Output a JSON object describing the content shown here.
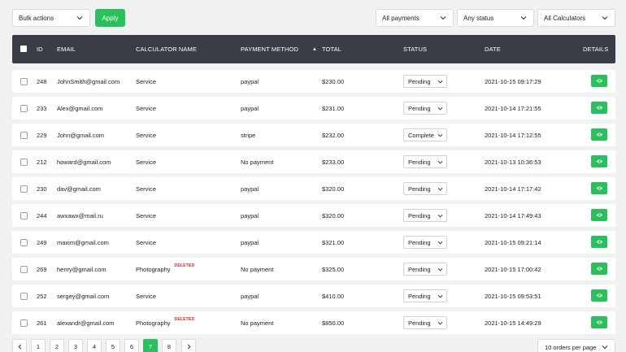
{
  "toolbar": {
    "bulk_actions": "Bulk actions",
    "apply_label": "Apply",
    "payments_filter": "All payments",
    "status_filter": "Any status",
    "calculators_filter": "All Calculators"
  },
  "table": {
    "headers": {
      "id": "ID",
      "email": "EMAIL",
      "calculator": "CALCULATOR NAME",
      "payment": "PAYMENT METHOD",
      "total": "TOTAL",
      "status": "STATUS",
      "date": "DATE",
      "details": "DETAILS"
    },
    "sort_indicator": "▲",
    "deleted_label": "DELETED",
    "rows": [
      {
        "id": "248",
        "email": "JohnSmith@gmail.com",
        "calculator": "Service",
        "deleted": false,
        "payment": "paypal",
        "total": "$230.00",
        "status": "Pending",
        "date": "2021-10-15 09:17:29"
      },
      {
        "id": "233",
        "email": "Alex@gmail.com",
        "calculator": "Service",
        "deleted": false,
        "payment": "paypal",
        "total": "$231.00",
        "status": "Pending",
        "date": "2021-10-14 17:21:55"
      },
      {
        "id": "229",
        "email": "John@gmail.com",
        "calculator": "Service",
        "deleted": false,
        "payment": "stripe",
        "total": "$232.00",
        "status": "Complete",
        "date": "2021-10-14 17:12:55"
      },
      {
        "id": "212",
        "email": "howard@gmail.com",
        "calculator": "Service",
        "deleted": false,
        "payment": "No payment",
        "total": "$233.00",
        "status": "Pending",
        "date": "2021-10-13 10:36:53"
      },
      {
        "id": "230",
        "email": "dav@gmail.com",
        "calculator": "Service",
        "deleted": false,
        "payment": "paypal",
        "total": "$320.00",
        "status": "Pending",
        "date": "2021-10-14 17:17:42"
      },
      {
        "id": "244",
        "email": "awxawx@mail.ru",
        "calculator": "Service",
        "deleted": false,
        "payment": "paypal",
        "total": "$320.00",
        "status": "Pending",
        "date": "2021-10-14 17:49:43"
      },
      {
        "id": "249",
        "email": "maxim@gmail.com",
        "calculator": "Service",
        "deleted": false,
        "payment": "paypal",
        "total": "$321.00",
        "status": "Pending",
        "date": "2021-10-15 09:21:14"
      },
      {
        "id": "269",
        "email": "henry@gmail.com",
        "calculator": "Photography",
        "deleted": true,
        "payment": "No payment",
        "total": "$325.00",
        "status": "Pending",
        "date": "2021-10-15 17:00:42"
      },
      {
        "id": "252",
        "email": "sergey@gmail.com",
        "calculator": "Service",
        "deleted": false,
        "payment": "paypal",
        "total": "$410.00",
        "status": "Pending",
        "date": "2021-10-15 09:53:51"
      },
      {
        "id": "261",
        "email": "alexandr@gmail.com",
        "calculator": "Photography",
        "deleted": true,
        "payment": "No payment",
        "total": "$850.00",
        "status": "Pending",
        "date": "2021-10-15 14:49:29"
      }
    ]
  },
  "pagination": {
    "prev": "‹",
    "next": "›",
    "pages": [
      "1",
      "2",
      "3",
      "4",
      "5",
      "6",
      "7",
      "8"
    ],
    "current": "7",
    "per_page": "10 orders per page"
  },
  "colors": {
    "accent": "#2bbf5e",
    "header_bg": "#3a3d45",
    "deleted": "#e0212d"
  }
}
